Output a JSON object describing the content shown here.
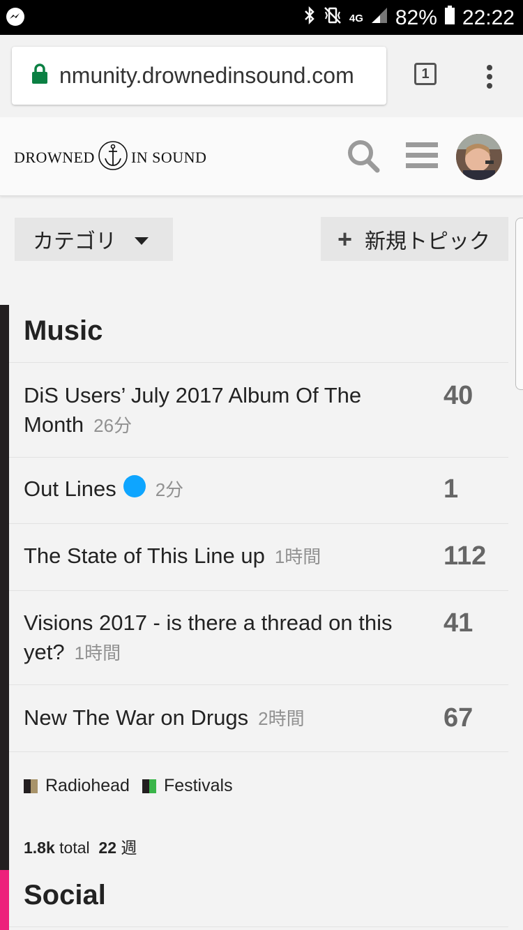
{
  "status_bar": {
    "battery": "82%",
    "time": "22:22",
    "network": "4G",
    "icons": [
      "messenger-icon",
      "bluetooth-icon",
      "vibrate-icon",
      "signal-icon",
      "battery-icon"
    ]
  },
  "browser": {
    "url": "nmunity.drownedinsound.com",
    "tab_count": "1",
    "lock_color": "#0b8043"
  },
  "header": {
    "logo_left": "DROWNED",
    "logo_right": "IN SOUND"
  },
  "toolbar": {
    "categories_label": "カテゴリ",
    "new_topic_label": "新規トピック"
  },
  "categories": [
    {
      "name": "Music",
      "color": "#231f20",
      "topics": [
        {
          "title": "DiS Users’ July 2017 Album Of The Month",
          "age": "26分",
          "replies": "40"
        },
        {
          "title": "Out Lines",
          "age": "2分",
          "replies": "1",
          "unread": true
        },
        {
          "title": "The State of This Line up",
          "age": "1時間",
          "replies": "112"
        },
        {
          "title": "Visions 2017 - is there a thread on this yet?",
          "age": "1時間",
          "replies": "41"
        },
        {
          "title": "New The War on Drugs",
          "age": "2時間",
          "replies": "67"
        }
      ],
      "subcategories": [
        {
          "name": "Radiohead",
          "colors": [
            "#231f20",
            "#a8936a"
          ]
        },
        {
          "name": "Festivals",
          "colors": [
            "#231f20",
            "#3ab54a"
          ]
        }
      ],
      "stats": {
        "total_value": "1.8k",
        "total_label": "total",
        "week_value": "22",
        "week_label": "週"
      }
    },
    {
      "name": "Social",
      "color": "#ed207b"
    }
  ]
}
